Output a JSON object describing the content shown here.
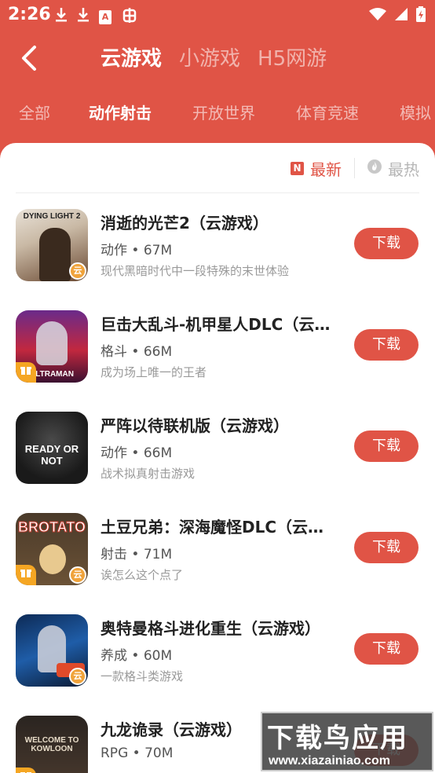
{
  "status_bar": {
    "time": "2:26",
    "left_icons": [
      "download-icon",
      "download-icon",
      "app-a-icon",
      "bug-app-icon"
    ],
    "app_a_letter": "A",
    "right_icons": [
      "wifi-icon",
      "cellular-signal-icon",
      "battery-icon"
    ]
  },
  "header": {
    "back_icon": "chevron-left-icon",
    "main_tabs": [
      {
        "label": "云游戏",
        "active": true
      },
      {
        "label": "小游戏",
        "active": false
      },
      {
        "label": "H5网游",
        "active": false
      }
    ],
    "category_tabs": [
      {
        "label": "全部",
        "active": false
      },
      {
        "label": "动作射击",
        "active": true
      },
      {
        "label": "开放世界",
        "active": false
      },
      {
        "label": "体育竞速",
        "active": false
      },
      {
        "label": "模拟",
        "active": false
      }
    ]
  },
  "sort": {
    "newest_label": "最新",
    "newest_icon_letter": "N",
    "hottest_label": "最热",
    "active": "newest"
  },
  "games": [
    {
      "title": "消逝的光芒2（云游戏）",
      "meta": "动作 • 67M",
      "desc": "现代黑暗时代中一段特殊的末世体验",
      "icon_text": "DYING LIGHT 2",
      "cloud": true,
      "gift": false
    },
    {
      "title": "巨击大乱斗-机甲星人DLC（云游戏）",
      "meta": "格斗 • 66M",
      "desc": "成为场上唯一的王者",
      "icon_text": "ULTRAMAN",
      "cloud": false,
      "gift": true
    },
    {
      "title": "严阵以待联机版（云游戏）",
      "meta": "动作 • 66M",
      "desc": "战术拟真射击游戏",
      "icon_text": "READY OR NOT",
      "cloud": false,
      "gift": false
    },
    {
      "title": "土豆兄弟：深海魔怪DLC（云游戏）",
      "meta": "射击 • 71M",
      "desc": "诶怎么这个点了",
      "icon_text": "BROTATO",
      "cloud": true,
      "gift": true
    },
    {
      "title": "奥特曼格斗进化重生（云游戏）",
      "meta": "养成 • 60M",
      "desc": "一款格斗类游戏",
      "icon_text": "",
      "cloud": true,
      "gift": false
    },
    {
      "title": "九龙诡录（云游戏）",
      "meta": "RPG • 70M",
      "desc": "",
      "icon_text": "WELCOME TO KOWLOON",
      "cloud": false,
      "gift": true
    }
  ],
  "download_label": "下载",
  "cloud_badge_label": "云",
  "watermark": {
    "big": "下载鸟应用",
    "small": "www.xiazainiao.com"
  },
  "colors": {
    "accent": "#e05446",
    "badge_orange": "#f0a33b"
  }
}
